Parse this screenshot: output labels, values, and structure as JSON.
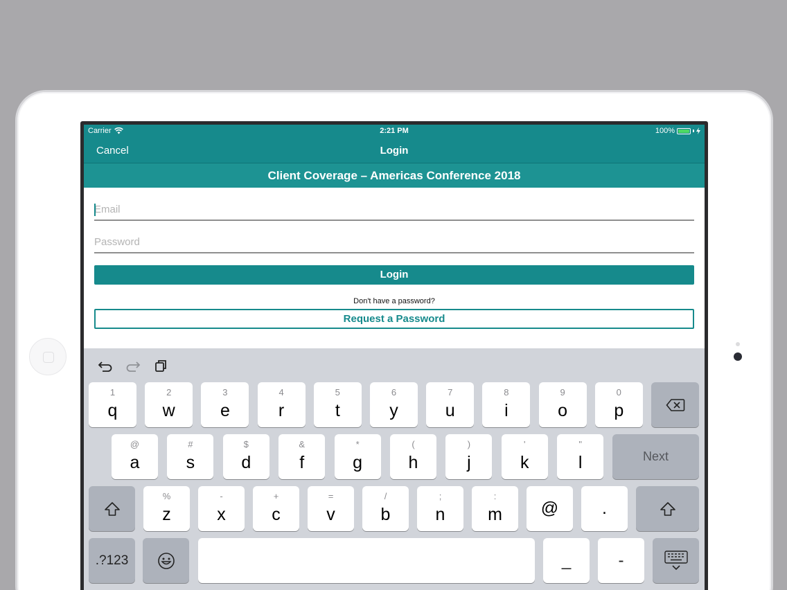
{
  "status_bar": {
    "carrier": "Carrier",
    "time": "2:21 PM",
    "battery": "100%"
  },
  "nav": {
    "cancel": "Cancel",
    "title": "Login"
  },
  "banner": "Client Coverage – Americas Conference 2018",
  "form": {
    "email_placeholder": "Email",
    "email_value": "",
    "password_placeholder": "Password",
    "password_value": "",
    "login_label": "Login",
    "hint": "Don't have a password?",
    "request_label": "Request a Password"
  },
  "keyboard": {
    "toolbar_icons": [
      "undo-icon",
      "redo-icon",
      "paste-icon"
    ],
    "row1": [
      {
        "sub": "1",
        "main": "q"
      },
      {
        "sub": "2",
        "main": "w"
      },
      {
        "sub": "3",
        "main": "e"
      },
      {
        "sub": "4",
        "main": "r"
      },
      {
        "sub": "5",
        "main": "t"
      },
      {
        "sub": "6",
        "main": "y"
      },
      {
        "sub": "7",
        "main": "u"
      },
      {
        "sub": "8",
        "main": "i"
      },
      {
        "sub": "9",
        "main": "o"
      },
      {
        "sub": "0",
        "main": "p"
      }
    ],
    "row2": [
      {
        "sub": "@",
        "main": "a"
      },
      {
        "sub": "#",
        "main": "s"
      },
      {
        "sub": "$",
        "main": "d"
      },
      {
        "sub": "&",
        "main": "f"
      },
      {
        "sub": "*",
        "main": "g"
      },
      {
        "sub": "(",
        "main": "h"
      },
      {
        "sub": ")",
        "main": "j"
      },
      {
        "sub": "'",
        "main": "k"
      },
      {
        "sub": "\"",
        "main": "l"
      }
    ],
    "row3": [
      {
        "sub": "%",
        "main": "z"
      },
      {
        "sub": "-",
        "main": "x"
      },
      {
        "sub": "+",
        "main": "c"
      },
      {
        "sub": "=",
        "main": "v"
      },
      {
        "sub": "/",
        "main": "b"
      },
      {
        "sub": ";",
        "main": "n"
      },
      {
        "sub": ":",
        "main": "m"
      },
      {
        "sub": "",
        "main": "@"
      },
      {
        "sub": "",
        "main": "."
      }
    ],
    "next_label": "Next",
    "numbers_label": ".?123",
    "underscore_label": "_",
    "dash_label": "-",
    "space_label": ""
  }
}
